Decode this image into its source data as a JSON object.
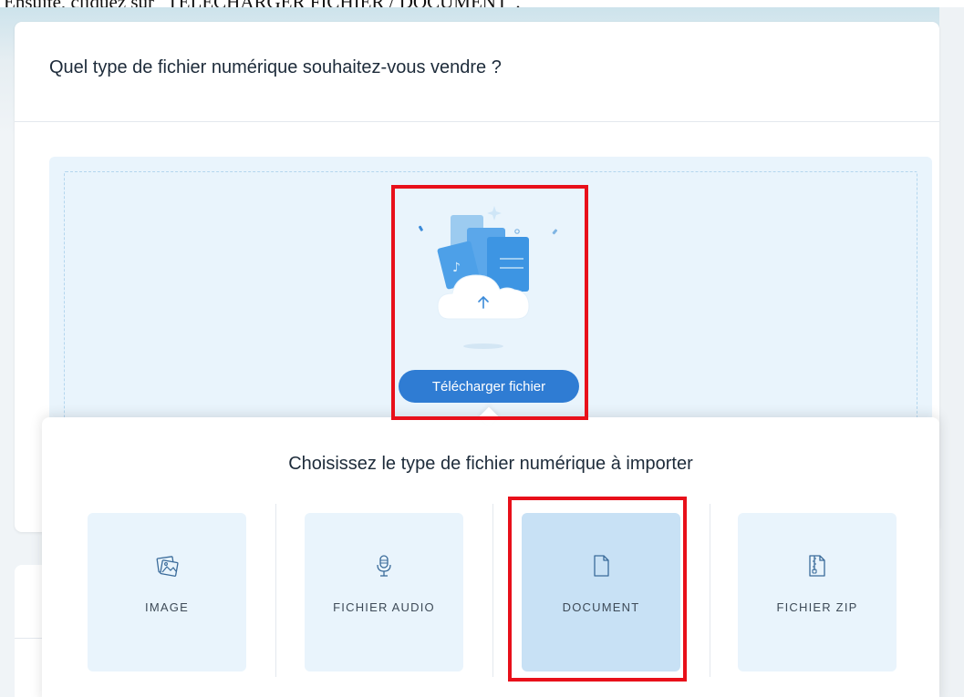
{
  "instruction_text": "Ensuite, cliquez sur \"TÉLÉCHARGER FICHIER / DOCUMENT\".",
  "card": {
    "title": "Quel type de fichier numérique souhaitez-vous vendre ?"
  },
  "dropzone": {
    "upload_button_label": "Télécharger fichier",
    "illustration_icon": "cloud-upload-icon"
  },
  "popover": {
    "title": "Choisissez le type de fichier numérique à importer",
    "options": [
      {
        "label": "IMAGE",
        "icon": "image-icon",
        "selected": false
      },
      {
        "label": "FICHIER AUDIO",
        "icon": "microphone-icon",
        "selected": false
      },
      {
        "label": "DOCUMENT",
        "icon": "document-icon",
        "selected": true
      },
      {
        "label": "FICHIER ZIP",
        "icon": "zip-file-icon",
        "selected": false
      }
    ]
  },
  "colors": {
    "accent": "#2f7cd3",
    "dropzone_bg": "#e9f4fc",
    "tile_selected_bg": "#c8e1f5",
    "highlight": "#e8101a"
  }
}
